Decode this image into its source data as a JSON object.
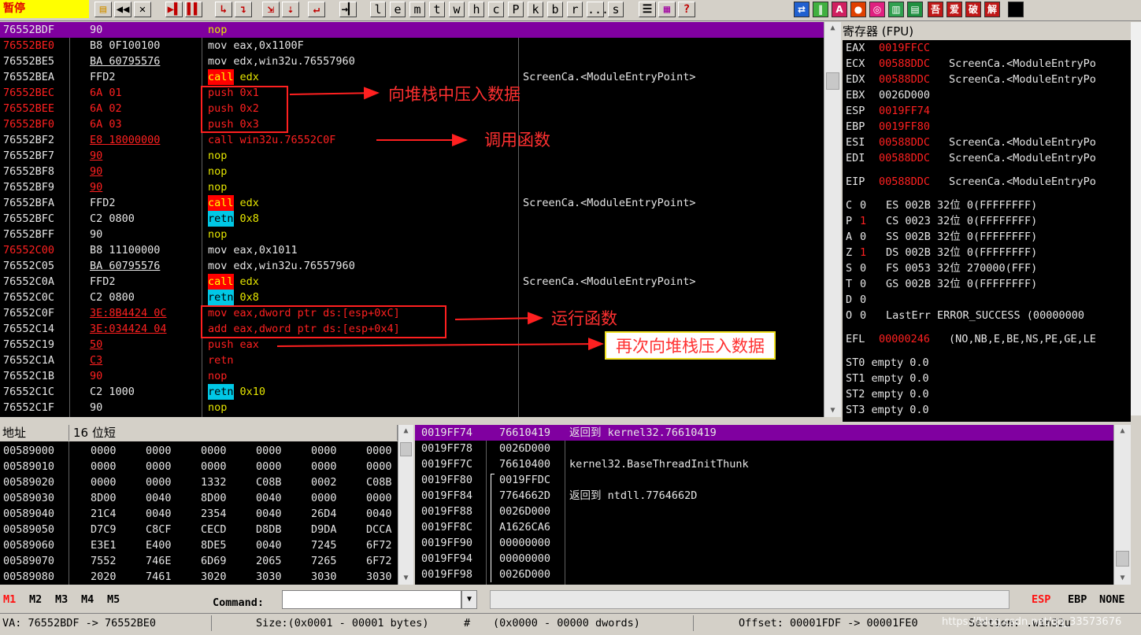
{
  "toolbar": {
    "status": "暂停",
    "letters": [
      "l",
      "e",
      "m",
      "t",
      "w",
      "h",
      "c",
      "P",
      "k",
      "b",
      "r",
      "...",
      "s"
    ],
    "plugins": [
      "吾",
      "爱",
      "破",
      "解"
    ]
  },
  "disasm": [
    {
      "addr": "76552BDF",
      "bytes": "90",
      "mnem": "nop",
      "args": "",
      "comment": "",
      "hl": true
    },
    {
      "addr": "76552BE0",
      "bytes": "B8 0F100100",
      "mnem": "mov",
      "args": "eax,0x1100F",
      "comment": "",
      "red": true
    },
    {
      "addr": "76552BE5",
      "bytes": "BA 60795576",
      "mnem": "mov",
      "args": "edx,win32u.76557960",
      "comment": "",
      "ub": true
    },
    {
      "addr": "76552BEA",
      "bytes": "FFD2",
      "mnem": "call",
      "args": "edx",
      "comment": "ScreenCa.<ModuleEntryPoint>",
      "call": true
    },
    {
      "addr": "76552BEC",
      "bytes": "6A 01",
      "mnem": "push",
      "args": "0x1",
      "comment": "",
      "red": true,
      "rbytes": true,
      "rins": true
    },
    {
      "addr": "76552BEE",
      "bytes": "6A 02",
      "mnem": "push",
      "args": "0x2",
      "comment": "",
      "red": true,
      "rbytes": true,
      "rins": true
    },
    {
      "addr": "76552BF0",
      "bytes": "6A 03",
      "mnem": "push",
      "args": "0x3",
      "comment": "",
      "red": true,
      "rbytes": true,
      "rins": true
    },
    {
      "addr": "76552BF2",
      "bytes": "E8 18000000",
      "mnem": "call",
      "args": "win32u.76552C0F",
      "comment": "",
      "rbytes": true,
      "rins": true,
      "ub": true
    },
    {
      "addr": "76552BF7",
      "bytes": "90",
      "mnem": "nop",
      "args": "",
      "comment": "",
      "rbytes": true,
      "ub": true
    },
    {
      "addr": "76552BF8",
      "bytes": "90",
      "mnem": "nop",
      "args": "",
      "comment": "",
      "rbytes": true,
      "ub": true
    },
    {
      "addr": "76552BF9",
      "bytes": "90",
      "mnem": "nop",
      "args": "",
      "comment": "",
      "rbytes": true,
      "ub": true
    },
    {
      "addr": "76552BFA",
      "bytes": "FFD2",
      "mnem": "call",
      "args": "edx",
      "comment": "ScreenCa.<ModuleEntryPoint>",
      "call": true
    },
    {
      "addr": "76552BFC",
      "bytes": "C2 0800",
      "mnem": "retn",
      "args": "0x8",
      "comment": "",
      "retn": true
    },
    {
      "addr": "76552BFF",
      "bytes": "90",
      "mnem": "nop",
      "args": "",
      "comment": ""
    },
    {
      "addr": "76552C00",
      "bytes": "B8 11100000",
      "mnem": "mov",
      "args": "eax,0x1011",
      "comment": "",
      "red": true
    },
    {
      "addr": "76552C05",
      "bytes": "BA 60795576",
      "mnem": "mov",
      "args": "edx,win32u.76557960",
      "comment": "",
      "ub": true
    },
    {
      "addr": "76552C0A",
      "bytes": "FFD2",
      "mnem": "call",
      "args": "edx",
      "comment": "ScreenCa.<ModuleEntryPoint>",
      "call": true
    },
    {
      "addr": "76552C0C",
      "bytes": "C2 0800",
      "mnem": "retn",
      "args": "0x8",
      "comment": "",
      "retn": true
    },
    {
      "addr": "76552C0F",
      "bytes": "3E:8B4424 0C",
      "mnem": "mov",
      "args": "eax,dword ptr ds:[esp+0xC]",
      "comment": "",
      "rbytes": true,
      "rins": true,
      "ub": true
    },
    {
      "addr": "76552C14",
      "bytes": "3E:034424 04",
      "mnem": "add",
      "args": "eax,dword ptr ds:[esp+0x4]",
      "comment": "",
      "rbytes": true,
      "rins": true,
      "ub": true
    },
    {
      "addr": "76552C19",
      "bytes": "50",
      "mnem": "push",
      "args": "eax",
      "comment": "",
      "rbytes": true,
      "rins": true,
      "ub": true
    },
    {
      "addr": "76552C1A",
      "bytes": "C3",
      "mnem": "retn",
      "args": "",
      "comment": "",
      "rbytes": true,
      "rins": true,
      "ub": true
    },
    {
      "addr": "76552C1B",
      "bytes": "90",
      "mnem": "nop",
      "args": "",
      "comment": "",
      "rbytes": true,
      "rins": true
    },
    {
      "addr": "76552C1C",
      "bytes": "C2 1000",
      "mnem": "retn",
      "args": "0x10",
      "comment": "",
      "retn": true
    },
    {
      "addr": "76552C1F",
      "bytes": "90",
      "mnem": "nop",
      "args": "",
      "comment": ""
    }
  ],
  "annotations": {
    "a1": "向堆栈中压入数据",
    "a2": "调用函数",
    "a3": "运行函数",
    "a4": "再次向堆栈压入数据"
  },
  "registers": {
    "title": "寄存器 (FPU)",
    "gp": [
      {
        "n": "EAX",
        "v": "0019FFCC",
        "c": ""
      },
      {
        "n": "ECX",
        "v": "00588DDC",
        "c": "ScreenCa.<ModuleEntryPo"
      },
      {
        "n": "EDX",
        "v": "00588DDC",
        "c": "ScreenCa.<ModuleEntryPo"
      },
      {
        "n": "EBX",
        "v": "0026D000",
        "c": "",
        "white": true
      },
      {
        "n": "ESP",
        "v": "0019FF74",
        "c": ""
      },
      {
        "n": "EBP",
        "v": "0019FF80",
        "c": ""
      },
      {
        "n": "ESI",
        "v": "00588DDC",
        "c": "ScreenCa.<ModuleEntryPo"
      },
      {
        "n": "EDI",
        "v": "00588DDC",
        "c": "ScreenCa.<ModuleEntryPo"
      }
    ],
    "eip": {
      "n": "EIP",
      "v": "00588DDC",
      "c": "ScreenCa.<ModuleEntryPo"
    },
    "flags": [
      {
        "f": "C",
        "v": "0",
        "seg": "ES 002B 32位 0(FFFFFFFF)"
      },
      {
        "f": "P",
        "v": "1",
        "seg": "CS 0023 32位 0(FFFFFFFF)"
      },
      {
        "f": "A",
        "v": "0",
        "seg": "SS 002B 32位 0(FFFFFFFF)"
      },
      {
        "f": "Z",
        "v": "1",
        "seg": "DS 002B 32位 0(FFFFFFFF)"
      },
      {
        "f": "S",
        "v": "0",
        "seg": "FS 0053 32位 270000(FFF)"
      },
      {
        "f": "T",
        "v": "0",
        "seg": "GS 002B 32位 0(FFFFFFFF)"
      },
      {
        "f": "D",
        "v": "0",
        "seg": ""
      },
      {
        "f": "O",
        "v": "0",
        "seg": "LastErr ERROR_SUCCESS (00000000"
      }
    ],
    "efl": {
      "n": "EFL",
      "v": "00000246",
      "c": "(NO,NB,E,BE,NS,PE,GE,LE"
    },
    "fpu": [
      "ST0 empty 0.0",
      "ST1 empty 0.0",
      "ST2 empty 0.0",
      "ST3 empty 0.0"
    ]
  },
  "dump": {
    "h_addr": "地址",
    "h_mode": "16 位短",
    "rows": [
      [
        "00589000",
        "0000",
        "0000",
        "0000",
        "0000",
        "0000",
        "0000"
      ],
      [
        "00589010",
        "0000",
        "0000",
        "0000",
        "0000",
        "0000",
        "0000"
      ],
      [
        "00589020",
        "0000",
        "0000",
        "1332",
        "C08B",
        "0002",
        "C08B"
      ],
      [
        "00589030",
        "8D00",
        "0040",
        "8D00",
        "0040",
        "0000",
        "0000"
      ],
      [
        "00589040",
        "21C4",
        "0040",
        "2354",
        "0040",
        "26D4",
        "0040"
      ],
      [
        "00589050",
        "D7C9",
        "C8CF",
        "CECD",
        "D8DB",
        "D9DA",
        "DCCA"
      ],
      [
        "00589060",
        "E3E1",
        "E400",
        "8DE5",
        "0040",
        "7245",
        "6F72"
      ],
      [
        "00589070",
        "7552",
        "746E",
        "6D69",
        "2065",
        "7265",
        "6F72"
      ],
      [
        "00589080",
        "2020",
        "7461",
        "3020",
        "3030",
        "3030",
        "3030"
      ]
    ]
  },
  "stack": [
    {
      "a": "0019FF74",
      "v": "76610419",
      "c": "返回到 kernel32.76610419",
      "hl": true
    },
    {
      "a": "0019FF78",
      "v": "0026D000",
      "c": ""
    },
    {
      "a": "0019FF7C",
      "v": "76610400",
      "c": "kernel32.BaseThreadInitThunk"
    },
    {
      "a": "0019FF80",
      "v": "0019FFDC",
      "c": ""
    },
    {
      "a": "0019FF84",
      "v": "7764662D",
      "c": "返回到 ntdll.7764662D"
    },
    {
      "a": "0019FF88",
      "v": "0026D000",
      "c": ""
    },
    {
      "a": "0019FF8C",
      "v": "A1626CA6",
      "c": ""
    },
    {
      "a": "0019FF90",
      "v": "00000000",
      "c": ""
    },
    {
      "a": "0019FF94",
      "v": "00000000",
      "c": ""
    },
    {
      "a": "0019FF98",
      "v": "0026D000",
      "c": ""
    }
  ],
  "bottom": {
    "m": [
      "M1",
      "M2",
      "M3",
      "M4",
      "M5"
    ],
    "command_label": "Command:",
    "esp": "ESP",
    "ebp": "EBP",
    "none": "NONE",
    "va": "VA: 76552BDF -> 76552BE0",
    "size": "Size:(0x0001 - 00001 bytes)",
    "hash": "#",
    "dwords": "(0x0000 - 00000 dwords)",
    "offset": "Offset: 00001FDF -> 00001FE0",
    "section": "Section: .win32u",
    "watermark": "https://blog.csdn.net/qq_33573676"
  }
}
